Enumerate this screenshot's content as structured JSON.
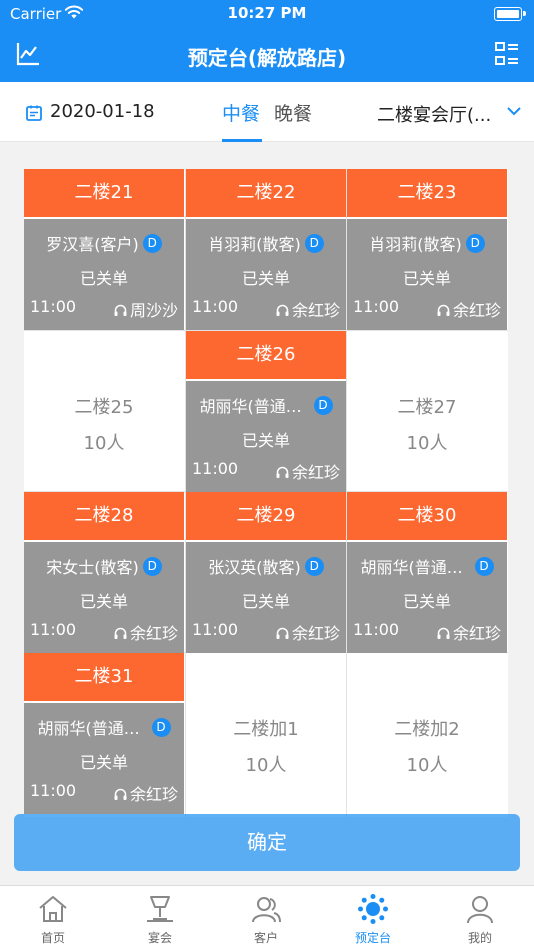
{
  "status_bar": {
    "carrier": "Carrier",
    "time": "10:27 PM"
  },
  "nav": {
    "title": "预定台(解放路店)"
  },
  "filter": {
    "date": "2020-01-18",
    "tabs": [
      {
        "label": "中餐",
        "active": true
      },
      {
        "label": "晚餐",
        "active": false
      }
    ],
    "hall": "二楼宴会厅(..."
  },
  "rooms": [
    {
      "name": "二楼21",
      "guest": "罗汉喜(客户)",
      "badge": "D",
      "status": "已关单",
      "time": "11:00",
      "staff": "周沙沙"
    },
    {
      "name": "二楼22",
      "guest": "肖羽莉(散客)",
      "badge": "D",
      "status": "已关单",
      "time": "11:00",
      "staff": "余红珍"
    },
    {
      "name": "二楼23",
      "guest": "肖羽莉(散客)",
      "badge": "D",
      "status": "已关单",
      "time": "11:00",
      "staff": "余红珍"
    },
    {
      "name": "二楼25",
      "capacity": "10人"
    },
    {
      "name": "二楼26",
      "guest": "胡丽华(普通会员)",
      "badge": "D",
      "status": "已关单",
      "time": "11:00",
      "staff": "余红珍"
    },
    {
      "name": "二楼27",
      "capacity": "10人"
    },
    {
      "name": "二楼28",
      "guest": "宋女士(散客)",
      "badge": "D",
      "status": "已关单",
      "time": "11:00",
      "staff": "余红珍"
    },
    {
      "name": "二楼29",
      "guest": "张汉英(散客)",
      "badge": "D",
      "status": "已关单",
      "time": "11:00",
      "staff": "余红珍"
    },
    {
      "name": "二楼30",
      "guest": "胡丽华(普通会员)",
      "badge": "D",
      "status": "已关单",
      "time": "11:00",
      "staff": "余红珍"
    },
    {
      "name": "二楼31",
      "guest": "胡丽华(普通会员)",
      "badge": "D",
      "status": "已关单",
      "time": "11:00",
      "staff": "余红珍"
    },
    {
      "name": "二楼加1",
      "capacity": "10人"
    },
    {
      "name": "二楼加2",
      "capacity": "10人"
    }
  ],
  "confirm_label": "确定",
  "tab_bar": [
    {
      "label": "首页",
      "icon": "home-icon"
    },
    {
      "label": "宴会",
      "icon": "banquet-icon"
    },
    {
      "label": "客户",
      "icon": "customer-icon"
    },
    {
      "label": "预定台",
      "icon": "booking-icon",
      "active": true
    },
    {
      "label": "我的",
      "icon": "profile-icon"
    }
  ],
  "colors": {
    "primary": "#1a8ef4",
    "room_header": "#fd6730",
    "booked_body": "#979797"
  }
}
